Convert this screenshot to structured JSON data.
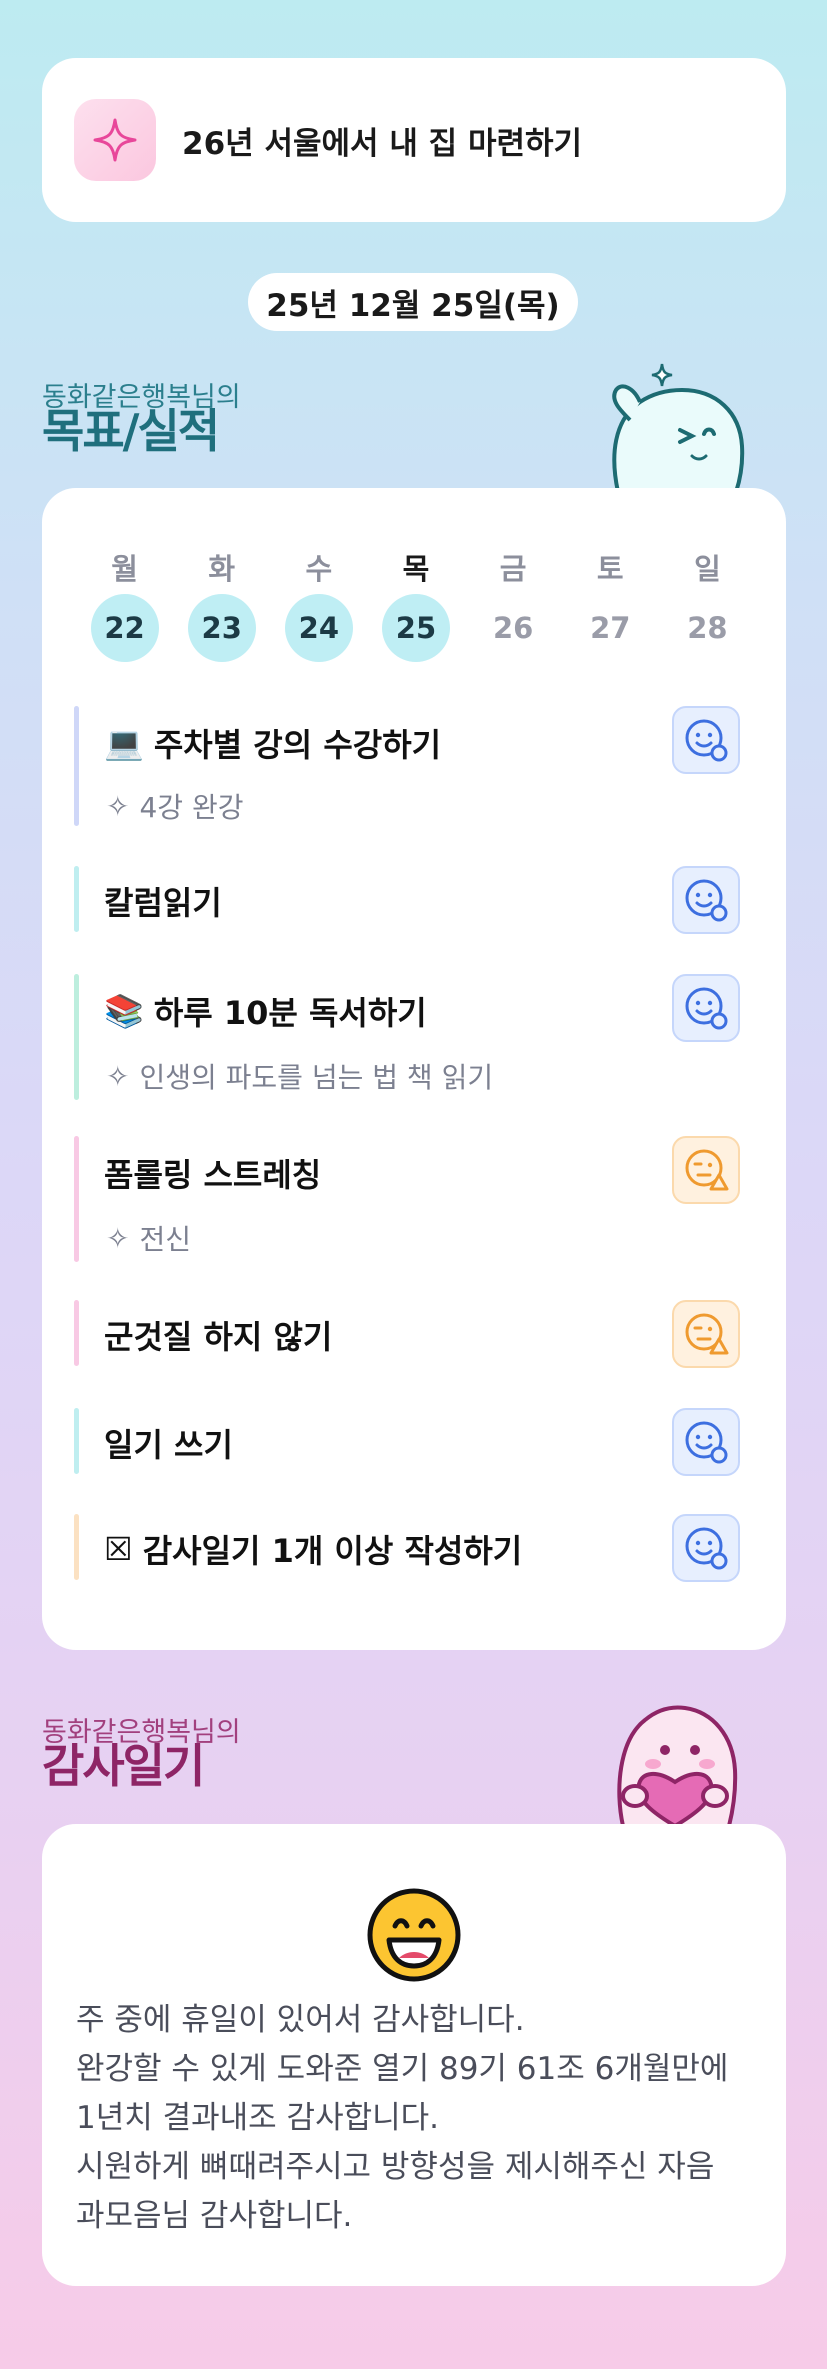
{
  "goal": {
    "title": "26년 서울에서 내 집 마련하기",
    "icon": "sparkle-icon"
  },
  "date": "25년 12월 25일(목)",
  "goals_section": {
    "subtitle": "동화같은행복님의",
    "title": "목표/실적"
  },
  "week": {
    "days": [
      "월",
      "화",
      "수",
      "목",
      "금",
      "토",
      "일"
    ],
    "dates": [
      "22",
      "23",
      "24",
      "25",
      "26",
      "27",
      "28"
    ],
    "completed_count": 4,
    "current_index": 3
  },
  "tasks": [
    {
      "emoji": "💻",
      "title": "주차별 강의 수강하기",
      "sub": "4강 완강",
      "status": "blue",
      "bar_color": "#cfd7f8"
    },
    {
      "emoji": "",
      "title": "칼럼읽기",
      "sub": "",
      "status": "blue",
      "bar_color": "#bfeef0"
    },
    {
      "emoji": "📚",
      "title": "하루 10분 독서하기",
      "sub": "인생의 파도를 넘는 법 책 읽기",
      "status": "blue",
      "bar_color": "#bdeede"
    },
    {
      "emoji": "",
      "title": "폼롤링 스트레칭",
      "sub": "전신",
      "status": "orange",
      "bar_color": "#f8c9e4"
    },
    {
      "emoji": "",
      "title": "군것질 하지 않기",
      "sub": "",
      "status": "orange",
      "bar_color": "#f8c9e4"
    },
    {
      "emoji": "",
      "title": "일기 쓰기",
      "sub": "",
      "status": "blue",
      "bar_color": "#bfeef0"
    },
    {
      "emoji": "☒",
      "title": "감사일기 1개 이상 작성하기",
      "sub": "",
      "status": "blue",
      "bar_color": "#fbe1c2"
    }
  ],
  "gratitude_section": {
    "subtitle": "동화같은행복님의",
    "title": "감사일기"
  },
  "gratitude": {
    "emoji": "grinning-face-icon",
    "lines": [
      "주 중에 휴일이 있어서 감사합니다.",
      "완강할 수 있게 도와준 열기 89기 61조 6개월만에",
      "1년치 결과내조 감사합니다.",
      "시원하게 뼈때려주시고 방향성을 제시해주신 자음",
      "과모음님 감사합니다."
    ]
  },
  "colors": {
    "accent_teal": "#1f6f7d",
    "accent_pink": "#8e2566",
    "status_blue": "#3d6fe0",
    "status_orange": "#ef9a2f"
  }
}
